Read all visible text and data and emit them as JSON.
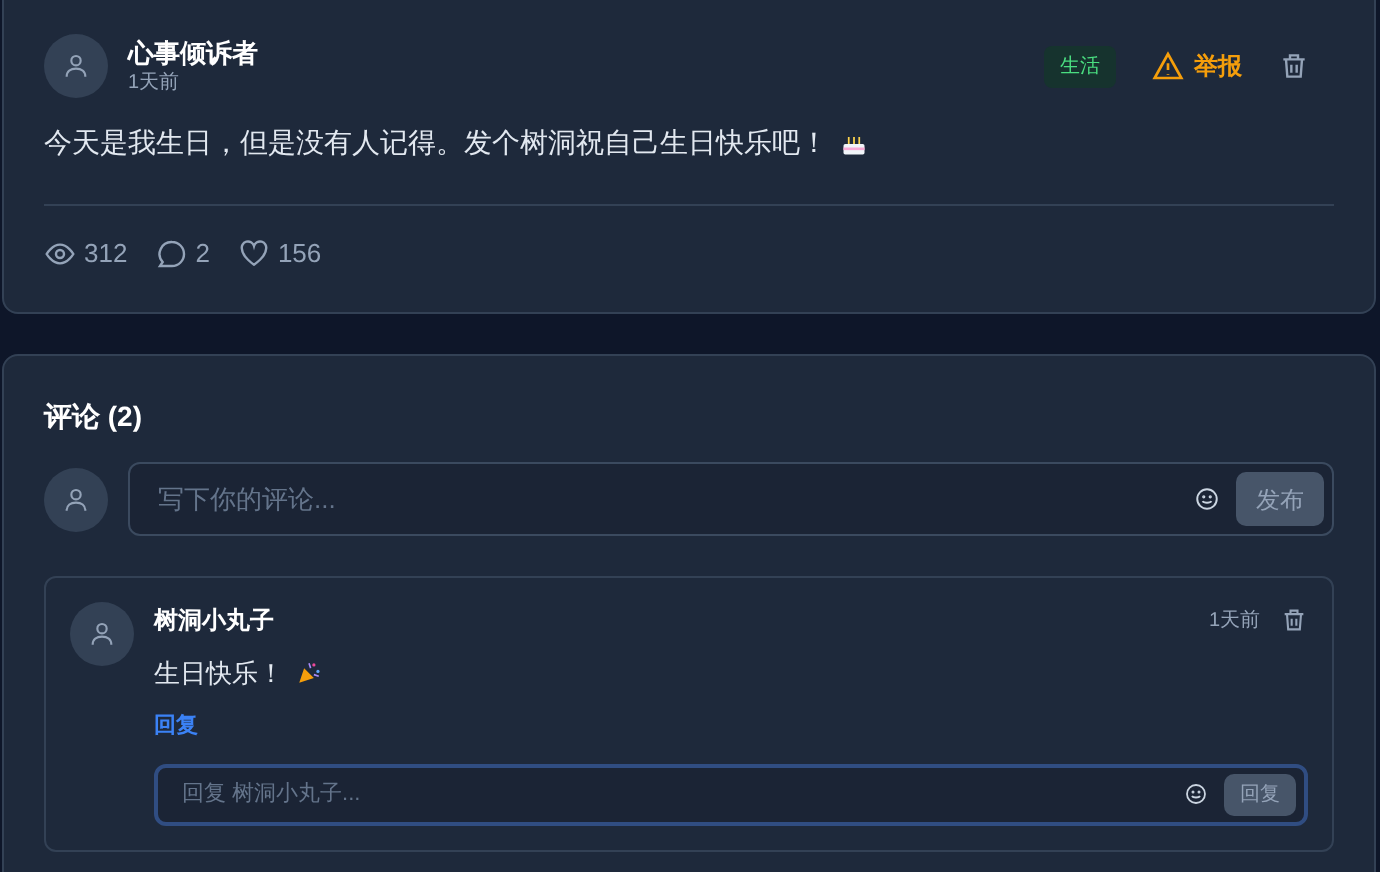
{
  "post": {
    "author": "心事倾诉者",
    "time": "1天前",
    "tag": "生活",
    "report": "举报",
    "content": "今天是我生日，但是没有人记得。发个树洞祝自己生日快乐吧！",
    "stats": {
      "views": "312",
      "comments": "2",
      "likes": "156"
    }
  },
  "comments_section": {
    "title": "评论 (2)",
    "input": {
      "placeholder": "写下你的评论..."
    },
    "submit": "发布",
    "comments": [
      {
        "author": "树洞小丸子",
        "time": "1天前",
        "content": "生日快乐！",
        "reply_link": "回复",
        "reply_open": true,
        "reply_placeholder": "回复 树洞小丸子...",
        "reply_submit": "回复"
      }
    ]
  }
}
